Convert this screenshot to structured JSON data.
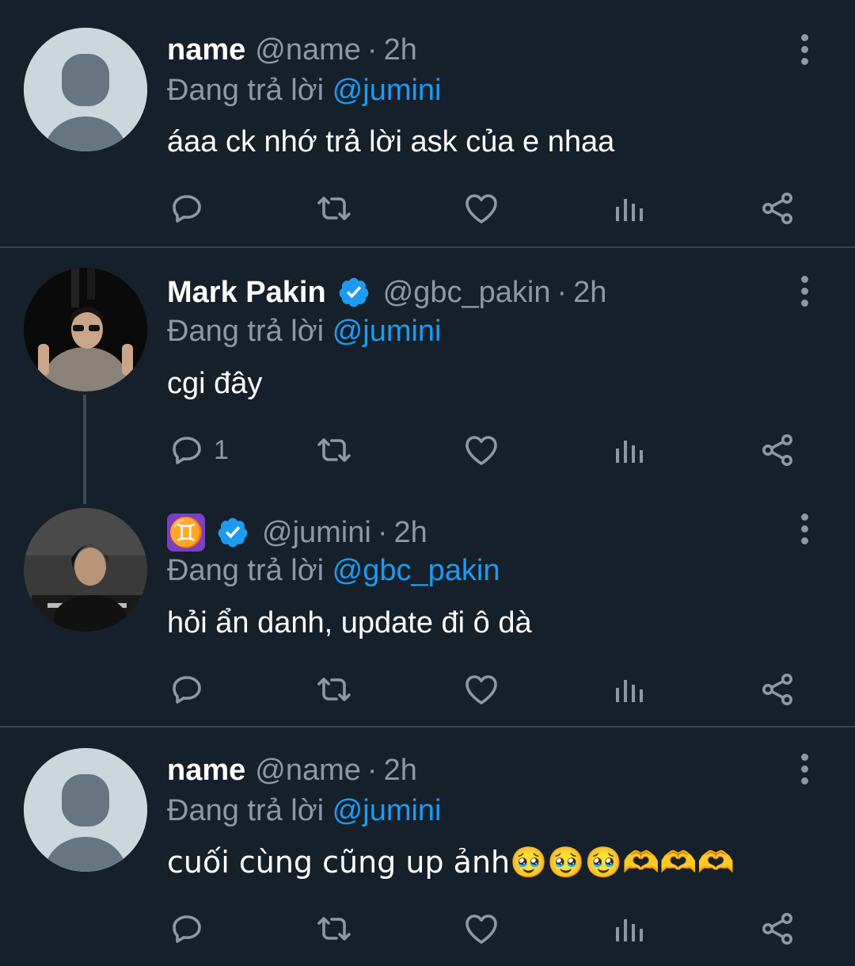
{
  "replying_label": "Đang trả lời",
  "tweets": [
    {
      "display_name": "name",
      "handle": "@name",
      "separator": "·",
      "time": "2h",
      "replying_to": "@jumini",
      "text": "áaa ck nhớ trả lời ask của e nhaa",
      "reply_count": ""
    },
    {
      "display_name": "Mark Pakin",
      "handle": "@gbc_pakin",
      "separator": "·",
      "time": "2h",
      "replying_to": "@jumini",
      "text": "cgi đây",
      "reply_count": "1",
      "verified": true
    },
    {
      "display_name": "♊",
      "handle": "@jumini",
      "separator": "·",
      "time": "2h",
      "replying_to": "@gbc_pakin",
      "text": "hỏi ẩn danh, update đi ô dà",
      "reply_count": "",
      "verified": true
    },
    {
      "display_name": "name",
      "handle": "@name",
      "separator": "·",
      "time": "2h",
      "replying_to": "@jumini",
      "text": "cuối cùng cũng up ảnh🥹🥹🥹🫶🫶🫶",
      "reply_count": ""
    }
  ],
  "colors": {
    "background": "#15202b",
    "divider": "#38444d",
    "mention": "#1d9bf0",
    "secondary": "#8b98a5",
    "verified": "#1d9bf0"
  },
  "icons": [
    "reply-icon",
    "retweet-icon",
    "like-icon",
    "analytics-icon",
    "share-icon",
    "more-options-icon",
    "verified-badge-icon"
  ]
}
